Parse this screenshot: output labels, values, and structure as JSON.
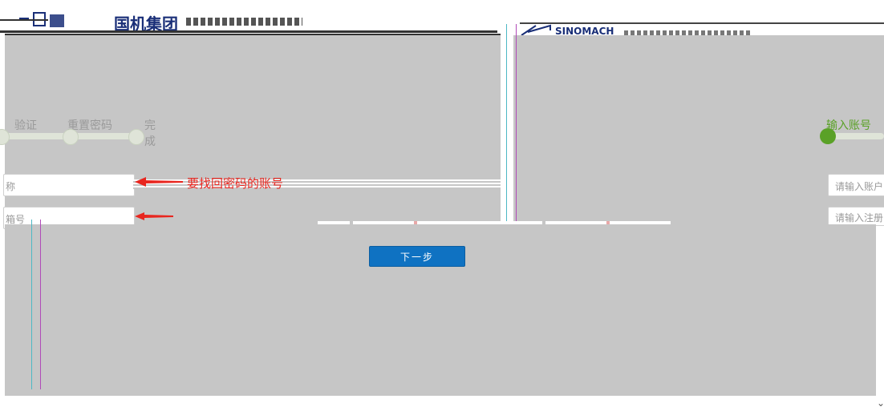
{
  "header": {
    "left_logo_text": "国机集团",
    "right_logo_text": "SINOMACH"
  },
  "steps_left": [
    "验证",
    "重置密码",
    "完成"
  ],
  "steps_right": [
    "输入账号"
  ],
  "annotations": {
    "account_note": "要找回密码的账号"
  },
  "fields": {
    "left_account_label": "称",
    "left_email_label": "箱号",
    "right_account_placeholder": "请输入账户",
    "right_email_placeholder": "请输入注册"
  },
  "buttons": {
    "next": "下一步"
  },
  "colors": {
    "page_bg": "#c6c6c6",
    "active_step": "#5aa127",
    "annotation": "#e8261f",
    "button": "#0f72c2"
  }
}
